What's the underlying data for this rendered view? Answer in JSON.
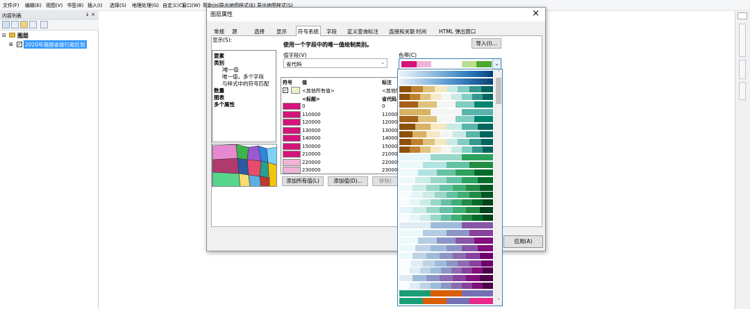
{
  "menu": [
    "文件(F)",
    "编辑(E)",
    "视图(V)",
    "书签(B)",
    "插入(I)",
    "选择(S)",
    "地理处理(G)",
    "自定义(C)",
    "窗口(W)",
    "帮助(H)",
    "导出地图样式(E)",
    "导出地图样式(S)"
  ],
  "toc": {
    "title": "内容列表",
    "pin": "↓ × ",
    "root": "图层",
    "layer": "2020年我国省级行政区划"
  },
  "dialog": {
    "title": "图层属性",
    "close": "×",
    "tabs": [
      "常规",
      "源",
      "选择",
      "显示",
      "符号系统",
      "字段",
      "定义查询",
      "标注",
      "连接和关联",
      "时间",
      "HTML 弹出窗口"
    ],
    "active_tab": "符号系统",
    "show_label": "显示(S):",
    "show_items": [
      {
        "text": "要素",
        "bold": true
      },
      {
        "text": "类别",
        "bold": true
      },
      {
        "text": "唯一值",
        "bold": false
      },
      {
        "text": "唯一值，多个字段",
        "bold": false
      },
      {
        "text": "与样式中的符号匹配",
        "bold": false
      },
      {
        "text": "数量",
        "bold": true
      },
      {
        "text": "图表",
        "bold": true
      },
      {
        "text": "多个属性",
        "bold": true
      }
    ],
    "heading": "使用一个字段中的唯一值绘制类别。",
    "import_button": "导入(I)...",
    "value_field_label": "值字段(V)",
    "value_field_value": "省代码",
    "color_ramp_label": "色带(C)",
    "table_headers": {
      "symbol": "符号",
      "value": "值",
      "label": "标注"
    },
    "table_rows": [
      {
        "value": "<其他所有值>",
        "label": "<其他所",
        "color": "#e6f3c9",
        "check": true
      },
      {
        "value": "<标题>",
        "label": "省代码",
        "color": "",
        "bold": true
      },
      {
        "value": "0",
        "label": "0",
        "color": "#d4147a"
      },
      {
        "value": "110000",
        "label": "110000",
        "color": "#d4147a"
      },
      {
        "value": "120000",
        "label": "120000",
        "color": "#d4147a"
      },
      {
        "value": "130000",
        "label": "130000",
        "color": "#d4147a"
      },
      {
        "value": "140000",
        "label": "140000",
        "color": "#d4147a"
      },
      {
        "value": "150000",
        "label": "150000",
        "color": "#d4147a"
      },
      {
        "value": "210000",
        "label": "210000",
        "color": "#d4147a"
      },
      {
        "value": "220000",
        "label": "220000",
        "color": "#f0b4d8"
      },
      {
        "value": "230000",
        "label": "230000",
        "color": "#f0b4d8"
      }
    ],
    "add_all_button": "添加所有值(L)",
    "add_button": "添加值(D)...",
    "remove_button": "移除(",
    "apply_button": "应用(A)"
  },
  "ramp_selected": [
    "#d4147a",
    "#f0b4d8",
    "#ffffff",
    "#ffffff",
    "#b6e08f",
    "#4ea72e"
  ],
  "ramps": [
    [
      "#e9f2fa",
      "#c9dff0",
      "#a4c9e6",
      "#7eb1da",
      "#5898cd",
      "#347fbf",
      "#1963a6",
      "#0a3d73"
    ],
    [
      "#e8f1f8",
      "#bcd7ec",
      "#8dbbdf",
      "#5e9ed2",
      "#3a7fbe",
      "#1f5f9e",
      "#0d3e6f"
    ],
    [
      "#8c510a",
      "#bf812d",
      "#dfc27d",
      "#f6e8c3",
      "#c7eae5",
      "#80cdc1",
      "#35978f",
      "#01665e"
    ],
    [
      "#8c510a",
      "#bf812d",
      "#dfc27d",
      "#f6e8c3",
      "#f5f5f5",
      "#c7eae5",
      "#80cdc1",
      "#35978f",
      "#01665e"
    ],
    [
      "#a6611a",
      "#dfc27d",
      "#f5f5f5",
      "#80cdc1",
      "#018571"
    ],
    [
      "#d8b365",
      "#f5f5f5",
      "#5ab4ac"
    ],
    [
      "#a6611a",
      "#dfc27d",
      "#f5f5f5",
      "#80cdc1",
      "#018571"
    ],
    [
      "#8c510a",
      "#d8b365",
      "#f6e8c3",
      "#c7eae5",
      "#5ab4ac",
      "#01665e"
    ],
    [
      "#8c510a",
      "#d8b365",
      "#f6e8c3",
      "#f5f5f5",
      "#c7eae5",
      "#5ab4ac",
      "#01665e"
    ],
    [
      "#8c510a",
      "#bf812d",
      "#dfc27d",
      "#f6e8c3",
      "#c7eae5",
      "#80cdc1",
      "#35978f",
      "#01665e"
    ],
    [
      "#8c510a",
      "#bf812d",
      "#dfc27d",
      "#f6e8c3",
      "#f5f5f5",
      "#c7eae5",
      "#80cdc1",
      "#35978f",
      "#01665e"
    ],
    [
      "#e5f5f9",
      "#99d8c9",
      "#2ca25f"
    ],
    [
      "#edf8fb",
      "#b2e2e2",
      "#66c2a4",
      "#238b45"
    ],
    [
      "#edf8fb",
      "#b2e2e2",
      "#66c2a4",
      "#2ca25f",
      "#006d2c"
    ],
    [
      "#edf8fb",
      "#ccece6",
      "#99d8c9",
      "#66c2a4",
      "#2ca25f",
      "#006d2c"
    ],
    [
      "#edf8fb",
      "#ccece6",
      "#99d8c9",
      "#66c2a4",
      "#41ae76",
      "#238b45",
      "#005824"
    ],
    [
      "#f7fcfd",
      "#e5f5f9",
      "#ccece6",
      "#99d8c9",
      "#66c2a4",
      "#41ae76",
      "#238b45",
      "#005824"
    ],
    [
      "#f7fcfd",
      "#e5f5f9",
      "#ccece6",
      "#99d8c9",
      "#66c2a4",
      "#41ae76",
      "#238b45",
      "#006d2c",
      "#00441b"
    ],
    [
      "#e5f5f9",
      "#ccece6",
      "#99d8c9",
      "#66c2a4",
      "#41ae76",
      "#238b45",
      "#00441b"
    ],
    [
      "#f7fcfd",
      "#e5f5f9",
      "#ccece6",
      "#99d8c9",
      "#66c2a4",
      "#41ae76",
      "#238b45",
      "#006d2c",
      "#00441b"
    ],
    [
      "#e0ecf4",
      "#9ebcda",
      "#8856a7"
    ],
    [
      "#edf8fb",
      "#b3cde3",
      "#8c96c6",
      "#88419d"
    ],
    [
      "#edf8fb",
      "#b3cde3",
      "#8c96c6",
      "#8856a7",
      "#810f7c"
    ],
    [
      "#edf8fb",
      "#bfd3e6",
      "#9ebcda",
      "#8c96c6",
      "#8856a7",
      "#810f7c"
    ],
    [
      "#edf8fb",
      "#bfd3e6",
      "#9ebcda",
      "#8c96c6",
      "#8c6bb1",
      "#88419d",
      "#6e016b"
    ],
    [
      "#f7fcfd",
      "#e0ecf4",
      "#bfd3e6",
      "#9ebcda",
      "#8c96c6",
      "#8c6bb1",
      "#88419d",
      "#6e016b"
    ],
    [
      "#f7fcfd",
      "#e0ecf4",
      "#bfd3e6",
      "#9ebcda",
      "#8c96c6",
      "#8c6bb1",
      "#88419d",
      "#810f7c",
      "#4d004b"
    ],
    [
      "#e0ecf4",
      "#9ebcda",
      "#8c96c6",
      "#8c6bb1",
      "#88419d",
      "#810f7c",
      "#4d004b"
    ],
    [
      "#f7fcfd",
      "#e0ecf4",
      "#bfd3e6",
      "#9ebcda",
      "#8c96c6",
      "#8c6bb1",
      "#88419d",
      "#810f7c",
      "#4d004b"
    ],
    [
      "#1b9e77",
      "#d95f02",
      "#7570b3"
    ],
    [
      "#1b9e77",
      "#d95f02",
      "#7570b3",
      "#e7298a"
    ]
  ],
  "ramp_gradient_rows": [
    0,
    1
  ]
}
